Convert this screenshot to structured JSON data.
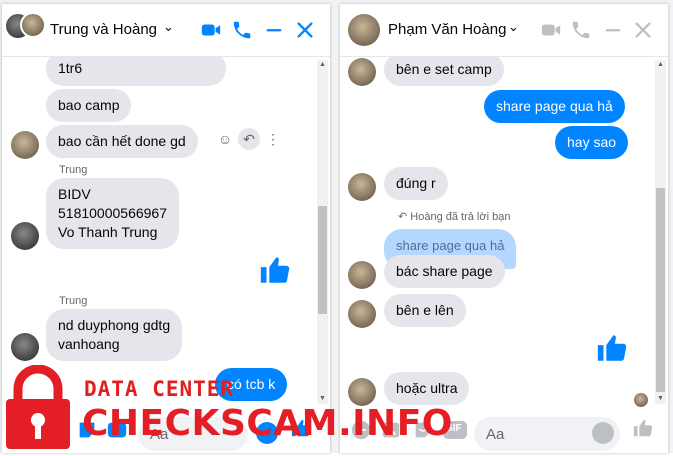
{
  "colors": {
    "messenger_blue": "#0084ff",
    "bubble_gray": "#e4e6eb",
    "watermark_red": "#e31e24"
  },
  "left_chat": {
    "title": "Trung và Hoàng",
    "messages": [
      {
        "text": "1tr6"
      },
      {
        "text": "bao camp"
      },
      {
        "text": "bao cần hết done gd"
      },
      {
        "sender": "Trung",
        "lines": [
          "BIDV",
          "51810000566967",
          "Vo Thanh Trung"
        ]
      },
      {
        "sender": "Trung",
        "lines": [
          "nd duyphong gdtg",
          "vanhoang"
        ]
      },
      {
        "text": "có tcb k"
      }
    ],
    "composer_placeholder": "Aa",
    "icons": [
      "video-icon",
      "phone-icon",
      "minimize-icon",
      "close-icon",
      "like-icon"
    ]
  },
  "right_chat": {
    "title": "Phạm Văn Hoàng",
    "messages": [
      {
        "text": "bên e set camp"
      },
      {
        "text": "share page qua hả"
      },
      {
        "text": "hay sao"
      },
      {
        "text": "đúng r"
      },
      {
        "reply_note": "Hoàng đã trả lời bạn",
        "quoted": "share page qua hả",
        "text": "bác share page"
      },
      {
        "text": "bên e lên"
      },
      {
        "text": "hoặc ultra"
      }
    ],
    "composer_placeholder": "Aa",
    "gif_label": "GIF"
  },
  "watermark": {
    "line1": "DATA CENTER",
    "line2": "CHECKSCAM.INFO"
  }
}
